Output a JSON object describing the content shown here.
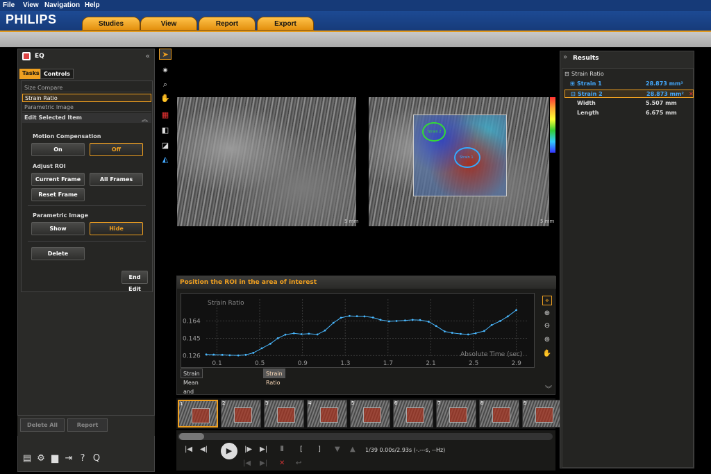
{
  "menu": [
    "File",
    "View",
    "Navigation",
    "Help"
  ],
  "brand": "PHILIPS",
  "header_tabs": [
    "Studies",
    "View",
    "Report",
    "Export"
  ],
  "left_panel": {
    "title": "EQ",
    "collapse_glyph": "«",
    "tabs": [
      "Tasks",
      "Controls"
    ],
    "tasks": [
      "Size Compare",
      "Strain Ratio",
      "Parametric Image"
    ],
    "selected_task": "Strain Ratio",
    "edit_section": "Edit Selected Item",
    "motion_comp_label": "Motion Compensation",
    "on_label": "On",
    "off_label": "Off",
    "adjust_roi_label": "Adjust ROI",
    "current_frame_label": "Current Frame",
    "all_frames_label": "All Frames",
    "reset_frame_label": "Reset Frame",
    "param_image_label": "Parametric Image",
    "show_label": "Show",
    "hide_label": "Hide",
    "delete_label": "Delete",
    "end_edit_label": "End Edit",
    "delete_all_label": "Delete All",
    "report_label": "Report"
  },
  "images": {
    "left_scale": "5 mm",
    "right_scale": "5 mm",
    "roi_labels": [
      "Strain 2",
      "Strain 1"
    ]
  },
  "graph": {
    "header": "Position the ROI in the area of interest",
    "tabs": [
      "Strain Mean and Std Dev",
      "Strain Ratio"
    ],
    "selected_tab": "Strain Ratio",
    "colors": {
      "line": "#49b8ff",
      "grid": "#3a3a3a"
    }
  },
  "chart_data": {
    "type": "line",
    "title": "Strain Ratio",
    "xlabel": "Absolute Time (sec)",
    "ylabel": "",
    "x_ticks": [
      "0.1",
      "0.5",
      "0.9",
      "1.3",
      "1.7",
      "2.1",
      "2.5",
      "2.9"
    ],
    "y_ticks": [
      "0.126",
      "0.145",
      "0.164"
    ],
    "xlim": [
      0.0,
      3.0
    ],
    "ylim": [
      0.124,
      0.188
    ],
    "series": [
      {
        "x": [
          0.0,
          0.07,
          0.15,
          0.22,
          0.3,
          0.37,
          0.44,
          0.52,
          0.6,
          0.67,
          0.74,
          0.82,
          0.89,
          0.96,
          1.04,
          1.11,
          1.19,
          1.26,
          1.34,
          1.41,
          1.48,
          1.56,
          1.63,
          1.71,
          1.78,
          1.86,
          1.93,
          2.0,
          2.08,
          2.15,
          2.23,
          2.3,
          2.38,
          2.45,
          2.52,
          2.6,
          2.67,
          2.75,
          2.82,
          2.9
        ],
        "y": [
          0.1272,
          0.127,
          0.1268,
          0.1264,
          0.1262,
          0.1268,
          0.129,
          0.134,
          0.139,
          0.145,
          0.149,
          0.1505,
          0.1495,
          0.15,
          0.1492,
          0.1535,
          0.162,
          0.1675,
          0.1695,
          0.1692,
          0.169,
          0.1678,
          0.1652,
          0.1636,
          0.164,
          0.1646,
          0.1652,
          0.165,
          0.1632,
          0.1585,
          0.1525,
          0.151,
          0.1498,
          0.1492,
          0.1505,
          0.153,
          0.1595,
          0.164,
          0.169,
          0.176
        ]
      }
    ]
  },
  "thumbnails": [
    "1",
    "2",
    "3",
    "4",
    "5",
    "6",
    "7",
    "8",
    "9"
  ],
  "player": {
    "frame_status": "1/39  0.00s/2.93s (-.---s, --Hz)"
  },
  "results": {
    "title": "Results",
    "expand_glyph": "»",
    "group": "Strain Ratio",
    "rows": [
      {
        "key": "Strain 1",
        "value": "28.873 mm²"
      },
      {
        "key": "Strain 2",
        "value": "28.873 mm²"
      },
      {
        "key": "Width",
        "value": "5.507 mm"
      },
      {
        "key": "Length",
        "value": "6.675 mm"
      }
    ]
  },
  "accent": "#f0a020"
}
